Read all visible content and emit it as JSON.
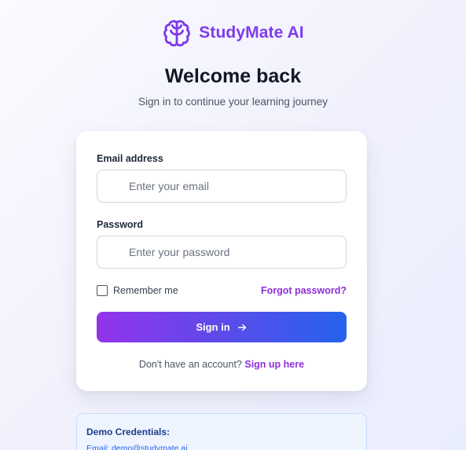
{
  "brand": {
    "name": "StudyMate AI",
    "logo_icon": "brain-icon",
    "accent": "#7e3bed"
  },
  "header": {
    "title": "Welcome back",
    "subtitle": "Sign in to continue your learning journey"
  },
  "form": {
    "email": {
      "label": "Email address",
      "placeholder": "Enter your email",
      "value": ""
    },
    "password": {
      "label": "Password",
      "placeholder": "Enter your password",
      "value": ""
    },
    "remember_label": "Remember me",
    "remember_checked": false,
    "forgot_label": "Forgot password?",
    "submit_label": "Sign in",
    "submit_icon": "arrow-right-icon",
    "signup_prompt": "Don't have an account?",
    "signup_link": "Sign up here"
  },
  "demo": {
    "title": "Demo Credentials:",
    "email_line": "Email: demo@studymate.ai"
  },
  "colors": {
    "gradient_start": "#9333ea",
    "gradient_end": "#2563eb",
    "link": "#8b2fd9"
  }
}
